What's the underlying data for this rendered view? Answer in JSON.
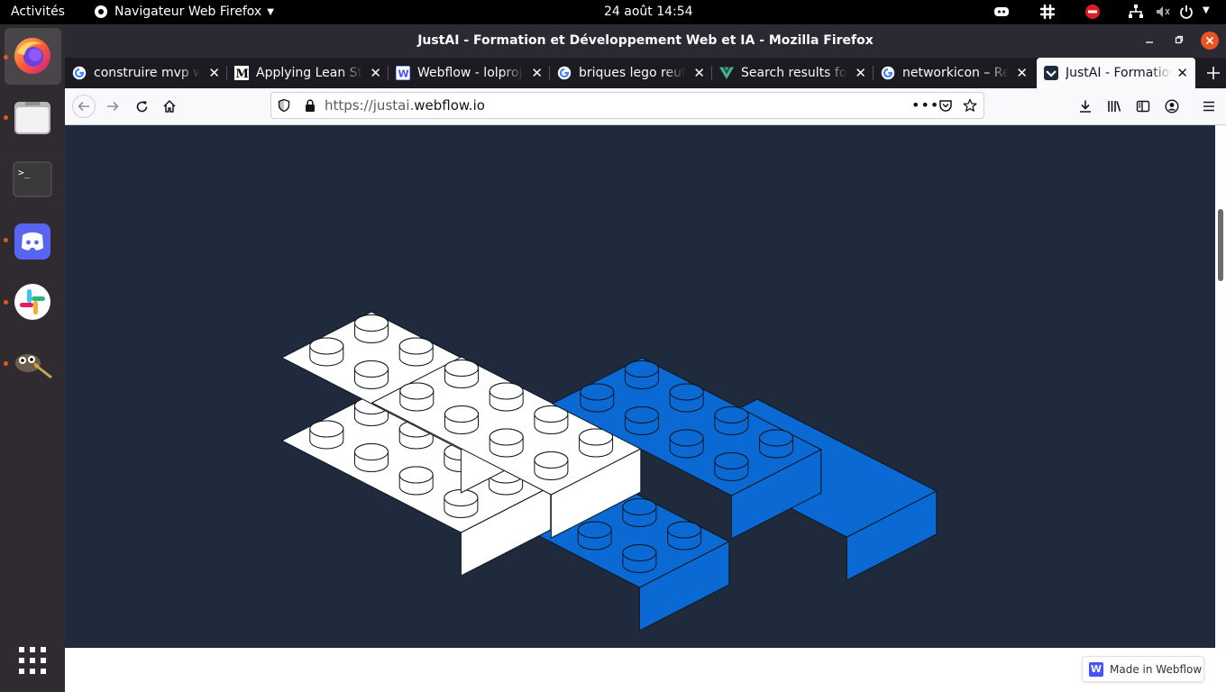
{
  "topbar": {
    "activities": "Activités",
    "app_menu": "Navigateur Web Firefox",
    "clock": "24 août  14:54"
  },
  "dock": {
    "apps": [
      "firefox-icon",
      "files-icon",
      "terminal-icon",
      "discord-icon",
      "slack-icon",
      "gimp-icon"
    ],
    "show_apps_icon": "grid-icon"
  },
  "window": {
    "title": "JustAI - Formation et Développement Web et IA - Mozilla Firefox"
  },
  "tabs": [
    {
      "label": "construire mvp wi",
      "favicon": "google-icon"
    },
    {
      "label": "Applying Lean Sta",
      "favicon": "medium-icon"
    },
    {
      "label": "Webflow - lolproje",
      "favicon": "webflow-icon"
    },
    {
      "label": "briques lego reutil",
      "favicon": "google-icon"
    },
    {
      "label": "Search results for",
      "favicon": "vue-icon"
    },
    {
      "label": "networkicon – Rec",
      "favicon": "google-icon"
    },
    {
      "label": "JustAI - Formation",
      "favicon": "justai-icon",
      "active": true
    }
  ],
  "urlbar": {
    "prefix": "https://justai.",
    "domain": "webflow.io",
    "suffix": ""
  },
  "badge": {
    "label": "Made in Webflow",
    "logo_letter": "W"
  },
  "colors": {
    "page_bg": "#1f2a3d",
    "brick_blue": "#0b69d4",
    "brick_white": "#ffffff",
    "accent_orange": "#e95420",
    "webflow_blue": "#4353ff"
  }
}
